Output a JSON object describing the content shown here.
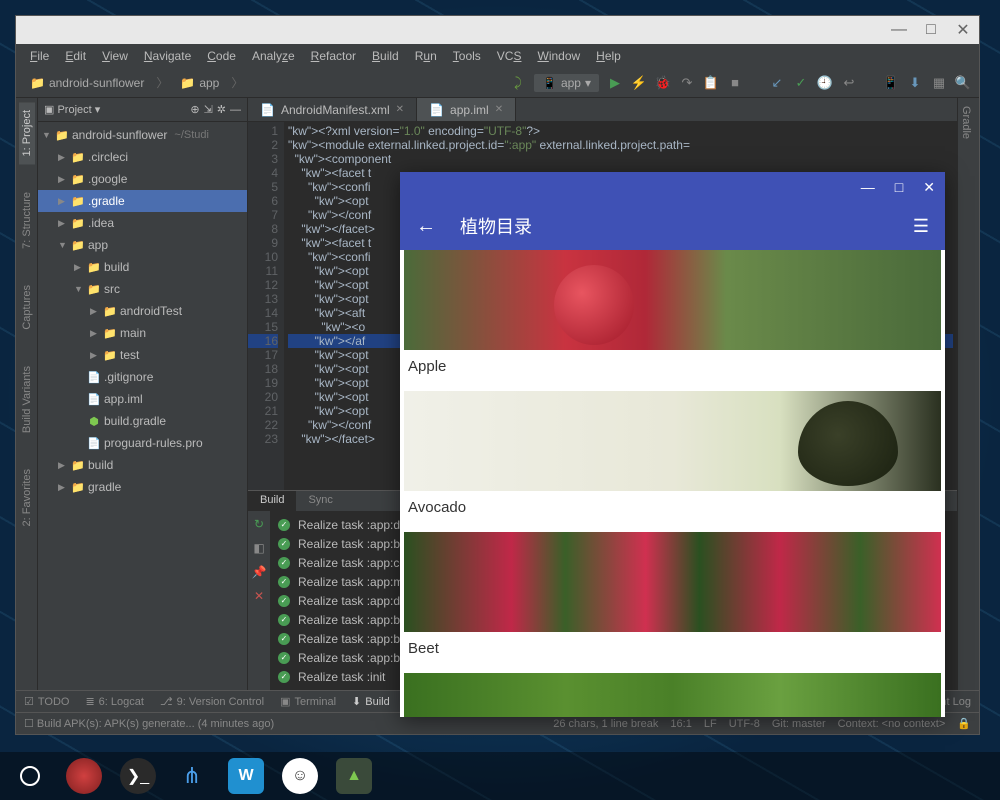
{
  "menu": [
    "File",
    "Edit",
    "View",
    "Navigate",
    "Code",
    "Analyze",
    "Refactor",
    "Build",
    "Run",
    "Tools",
    "VCS",
    "Window",
    "Help"
  ],
  "breadcrumbs": {
    "root": "android-sunflower",
    "module": "app"
  },
  "runconfig": "app",
  "project_panel": {
    "title": "Project"
  },
  "tree": {
    "root": "android-sunflower",
    "root_hint": "~/Studi",
    "items": [
      {
        "l": 1,
        "t": "d",
        "n": ".circleci"
      },
      {
        "l": 1,
        "t": "d",
        "n": ".google"
      },
      {
        "l": 1,
        "t": "d",
        "n": ".gradle",
        "sel": true,
        "orange": true
      },
      {
        "l": 1,
        "t": "d",
        "n": ".idea"
      },
      {
        "l": 1,
        "t": "d",
        "n": "app",
        "open": true
      },
      {
        "l": 2,
        "t": "d",
        "n": "build"
      },
      {
        "l": 2,
        "t": "d",
        "n": "src",
        "open": true
      },
      {
        "l": 3,
        "t": "d",
        "n": "androidTest"
      },
      {
        "l": 3,
        "t": "d",
        "n": "main"
      },
      {
        "l": 3,
        "t": "d",
        "n": "test"
      },
      {
        "l": 2,
        "t": "f",
        "n": ".gitignore"
      },
      {
        "l": 2,
        "t": "f",
        "n": "app.iml"
      },
      {
        "l": 2,
        "t": "g",
        "n": "build.gradle"
      },
      {
        "l": 2,
        "t": "f",
        "n": "proguard-rules.pro"
      },
      {
        "l": 1,
        "t": "d",
        "n": "build"
      },
      {
        "l": 1,
        "t": "d",
        "n": "gradle"
      }
    ]
  },
  "editor_tabs": [
    {
      "name": "AndroidManifest.xml",
      "active": false
    },
    {
      "name": "app.iml",
      "active": true
    }
  ],
  "code_lines": [
    "<?xml version=\"1.0\" encoding=\"UTF-8\"?>",
    "<module external.linked.project.id=\":app\" external.linked.project.path=",
    "  <component",
    "    <facet t",
    "      <confi",
    "        <opt",
    "      </conf",
    "    </facet>",
    "    <facet t",
    "      <confi",
    "        <opt",
    "        <opt",
    "        <opt",
    "        <aft",
    "          <o",
    "        </af",
    "        <opt",
    "        <opt",
    "        <opt",
    "        <opt",
    "        <opt",
    "      </conf",
    "    </facet>"
  ],
  "code_selected_line": 16,
  "build": {
    "tabs": [
      "Build",
      "Sync"
    ],
    "lines": [
      "Realize task :app:dependencies",
      "Realize task :app:buildEnvironment",
      "Realize task :app:components",
      "Realize task :app:model",
      "Realize task :app:dependentComponents",
      "Realize task :app:build",
      "Realize task :app:buildDependents",
      "Realize task :app:buildNeeded",
      "Realize task :init"
    ]
  },
  "bottom_tabs": {
    "todo": "TODO",
    "logcat": "6: Logcat",
    "vcs": "9: Version Control",
    "terminal": "Terminal",
    "build": "Build",
    "eventlog": "Event Log"
  },
  "status": {
    "main": "Build APK(s): APK(s) generate... (4 minutes ago)",
    "chars": "26 chars, 1 line break",
    "pos": "16:1",
    "lf": "LF",
    "enc": "UTF-8",
    "git": "Git: master",
    "ctx": "Context: <no context>"
  },
  "left_rail": [
    "1: Project",
    "7: Structure",
    "Captures",
    "Build Variants",
    "2: Favorites"
  ],
  "right_rail": "Gradle",
  "emulator": {
    "title": "植物目录",
    "plants": [
      "Apple",
      "Avocado",
      "Beet",
      ""
    ]
  }
}
